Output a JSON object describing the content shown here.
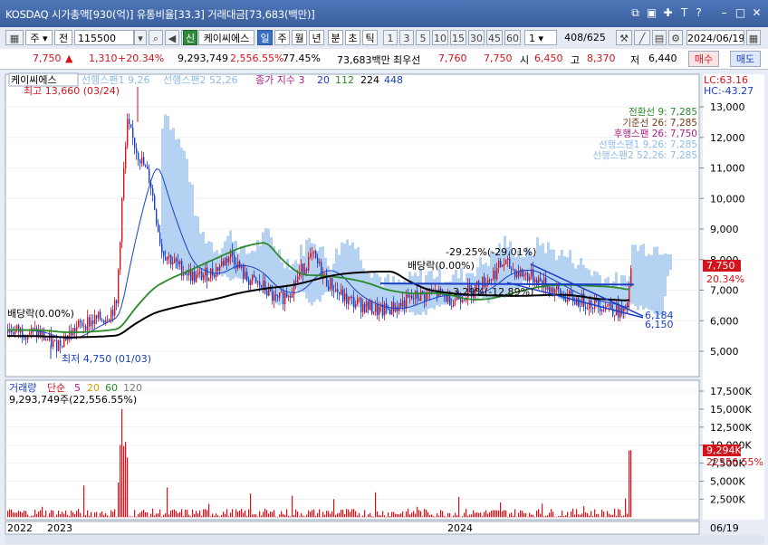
{
  "titlebar": {
    "title": "KOSDAQ 시가총액[930(억)] 유통비율[33.3] 거래대금[73,683(백만)]",
    "icons": [
      "restore-icon",
      "window-icon",
      "pin-icon",
      "text-icon",
      "help-icon",
      "minimize-icon",
      "maximize-icon",
      "close-icon"
    ]
  },
  "toolbar": {
    "market_type": "주",
    "market_select": "전",
    "code": "115500",
    "new_label": "신",
    "stock_name": "케이씨에스",
    "period_tabs": [
      "일",
      "주",
      "월",
      "년",
      "분",
      "초",
      "틱"
    ],
    "active_period": "일",
    "intervals": [
      "1",
      "3",
      "5",
      "10",
      "15",
      "30",
      "45",
      "60"
    ],
    "interval_value": "1",
    "count": "408/625",
    "date": "2024/06/19"
  },
  "quote": {
    "price": "7,750",
    "change": "1,310",
    "change_pct": "+20.34%",
    "volume": "9,293,749",
    "volume_ratio": "2,556.55%",
    "percent_77": "77.45%",
    "trade_value": "73,683백만",
    "pref_label": "최우선",
    "best_ask": "7,760",
    "best_bid": "7,750",
    "open_label": "시",
    "open": "6,450",
    "high_label": "고",
    "high": "8,370",
    "low_label": "저",
    "low": "6,440",
    "buy_label": "매수",
    "sell_label": "매도"
  },
  "price_panel": {
    "legend": {
      "name": "케이씨에스",
      "span1": "선행스팬1 9,26",
      "span2": "선행스팬2 52,26",
      "close": "종가 지수 3",
      "ma_20": "20",
      "ma_112": "112",
      "ma_224": "224",
      "ma_448": "448"
    },
    "lc": "LC:63.16",
    "hc": "HC:-43.27",
    "ichimoku": [
      "전환선 9: 7,285",
      "기준선 26: 7,285",
      "후행스팬 26: 7,750",
      "선행스팬1 9,26: 7,285",
      "선행스팬2 52,26: 7,285"
    ],
    "high_mark": "최고 13,660 (03/24)",
    "low_mark": "최저 4,750 (01/03)",
    "div_left": "배당락(0.00%)",
    "div_mid": "배당락(0.00%)",
    "pct_upper": "-29.25%(-29.01%)",
    "pct_lower": "-3.29%(-12.89%)",
    "trend_labels": [
      "6,184",
      "6,150"
    ],
    "price_box": "7,750",
    "pct_box": "20.34%",
    "y_ticks": [
      "13,000",
      "12,000",
      "11,000",
      "10,000",
      "9,000",
      "8,000",
      "7,000",
      "6,000",
      "5,000"
    ]
  },
  "volume_panel": {
    "legend": {
      "title": "거래량",
      "simple": "단순",
      "ma5": "5",
      "ma20": "20",
      "ma60": "60",
      "ma120": "120"
    },
    "summary": "9,293,749주(22,556.55%)",
    "y_ticks": [
      "17,500K",
      "15,000K",
      "12,500K",
      "10,000K",
      "7,500K",
      "5,000K",
      "2,500K"
    ],
    "vol_box": "9,294K",
    "ratio_box": "22556.55%"
  },
  "x_axis": {
    "labels": [
      "2022",
      "2023",
      "2024",
      "06/19"
    ]
  },
  "colors": {
    "up": "#d4141c",
    "down": "#1a3fc4",
    "cloud": "#9cc3ee",
    "ma20": "#1a3fc4",
    "ma112": "#2a8a2a",
    "ma224": "#000000",
    "title": "#3b5f9e"
  }
}
